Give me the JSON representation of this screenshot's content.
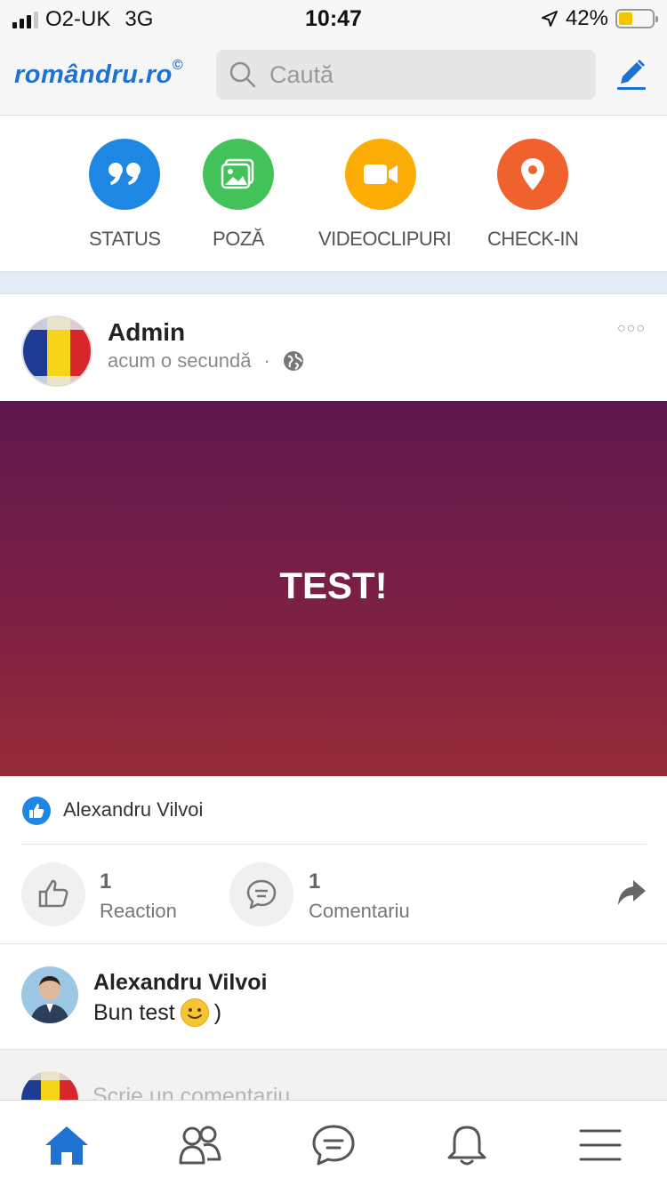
{
  "status_bar": {
    "carrier": "O2-UK",
    "network": "3G",
    "time": "10:47",
    "battery": "42%",
    "battery_level": 0.42
  },
  "header": {
    "logo": "romândru.ro",
    "logo_mark": "©",
    "search_placeholder": "Caută",
    "accent_color": "#1e73d2"
  },
  "composer": {
    "actions": [
      {
        "label": "STATUS",
        "icon": "quote-icon",
        "color": "#1e87e3"
      },
      {
        "label": "POZĂ",
        "icon": "photo-icon",
        "color": "#43c25a"
      },
      {
        "label": "VIDEOCLIPURI",
        "icon": "video-camera-icon",
        "color": "#fbad05"
      },
      {
        "label": "CHECK-IN",
        "icon": "map-pin-icon",
        "color": "#f0622d"
      }
    ]
  },
  "post": {
    "author": "Admin",
    "time": "acum o secundă",
    "privacy_icon": "globe-icon",
    "text": "TEST!",
    "gradient": [
      "#5e184e",
      "#962b38"
    ],
    "liked_by": "Alexandru Vilvoi",
    "reaction_count": "1",
    "reaction_label": "Reaction",
    "comment_count": "1",
    "comment_label": "Comentariu"
  },
  "comment": {
    "author": "Alexandru Vilvoi",
    "text": "Bun test",
    "suffix": ")"
  },
  "write_comment": {
    "placeholder": "Scrie un comentariu"
  },
  "tabbar": {
    "tabs": [
      {
        "icon": "home-icon",
        "active": true
      },
      {
        "icon": "friends-icon",
        "active": false
      },
      {
        "icon": "chat-icon",
        "active": false
      },
      {
        "icon": "bell-icon",
        "active": false
      },
      {
        "icon": "menu-icon",
        "active": false
      }
    ]
  }
}
